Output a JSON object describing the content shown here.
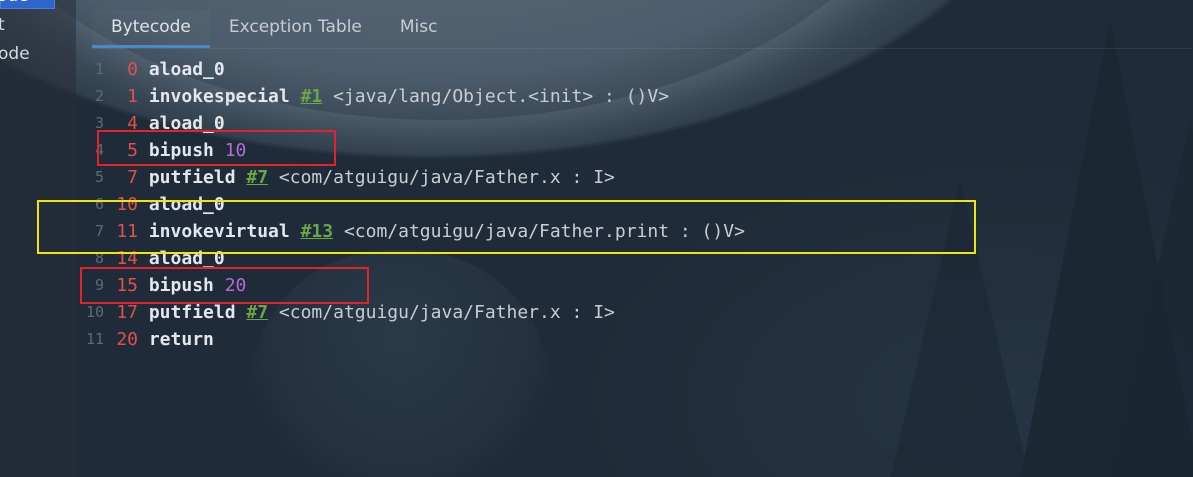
{
  "sidebar": {
    "selected_label": "ode",
    "items": [
      "t",
      "ode"
    ]
  },
  "tabs": [
    "Bytecode",
    "Exception Table",
    "Misc"
  ],
  "active_tab": "Bytecode",
  "lines": [
    {
      "ln": "1",
      "offset": "0",
      "opcode": "aload_0",
      "ref": "",
      "num": "",
      "comment": ""
    },
    {
      "ln": "2",
      "offset": "1",
      "opcode": "invokespecial",
      "ref": "#1",
      "num": "",
      "comment": "<java/lang/Object.<init> : ()V>"
    },
    {
      "ln": "3",
      "offset": "4",
      "opcode": "aload_0",
      "ref": "",
      "num": "",
      "comment": ""
    },
    {
      "ln": "4",
      "offset": "5",
      "opcode": "bipush",
      "ref": "",
      "num": "10",
      "comment": ""
    },
    {
      "ln": "5",
      "offset": "7",
      "opcode": "putfield",
      "ref": "#7",
      "num": "",
      "comment": "<com/atguigu/java/Father.x : I>"
    },
    {
      "ln": "6",
      "offset": "10",
      "opcode": "aload_0",
      "ref": "",
      "num": "",
      "comment": ""
    },
    {
      "ln": "7",
      "offset": "11",
      "opcode": "invokevirtual",
      "ref": "#13",
      "num": "",
      "comment": "<com/atguigu/java/Father.print : ()V>"
    },
    {
      "ln": "8",
      "offset": "14",
      "opcode": "aload_0",
      "ref": "",
      "num": "",
      "comment": ""
    },
    {
      "ln": "9",
      "offset": "15",
      "opcode": "bipush",
      "ref": "",
      "num": "20",
      "comment": ""
    },
    {
      "ln": "10",
      "offset": "17",
      "opcode": "putfield",
      "ref": "#7",
      "num": "",
      "comment": "<com/atguigu/java/Father.x : I>"
    },
    {
      "ln": "11",
      "offset": "20",
      "opcode": "return",
      "ref": "",
      "num": "",
      "comment": ""
    }
  ],
  "colors": {
    "offset": "#e0504f",
    "ref": "#6aa746",
    "number": "#b06fd1",
    "highlight_red": "#e0252a",
    "highlight_yellow": "#f2e312"
  }
}
